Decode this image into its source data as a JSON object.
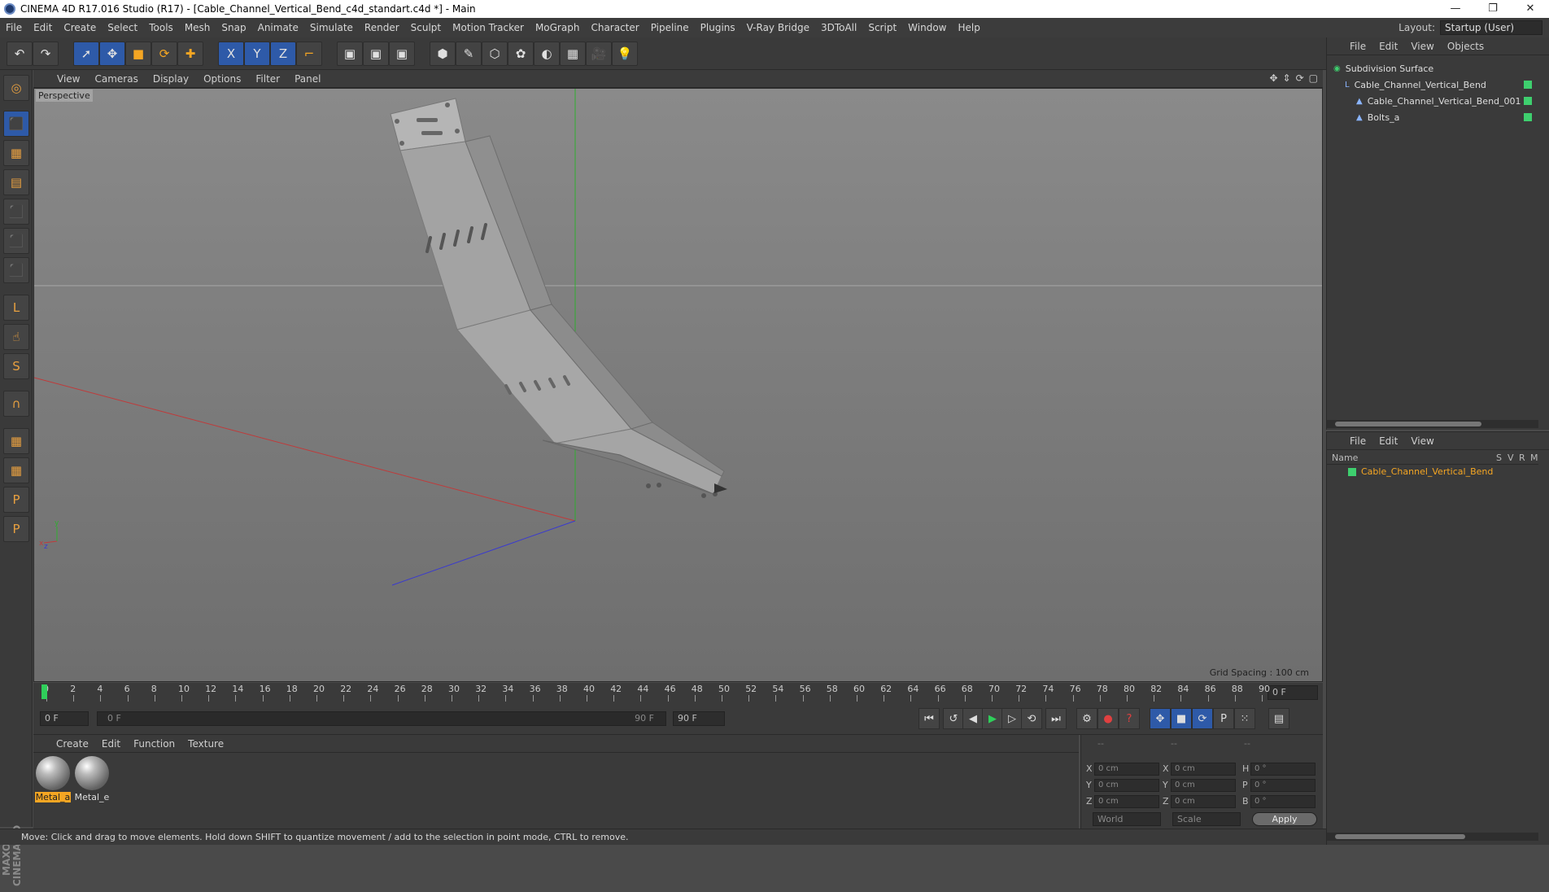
{
  "window": {
    "title": "CINEMA 4D R17.016 Studio (R17) - [Cable_Channel_Vertical_Bend_c4d_standart.c4d *] - Main",
    "minimize_icon": "minimize-icon",
    "restore_icon": "restore-icon",
    "close_icon": "close-icon"
  },
  "menu": {
    "items": [
      "File",
      "Edit",
      "Create",
      "Select",
      "Tools",
      "Mesh",
      "Snap",
      "Animate",
      "Simulate",
      "Render",
      "Sculpt",
      "Motion Tracker",
      "MoGraph",
      "Character",
      "Pipeline",
      "Plugins",
      "V-Ray Bridge",
      "3DToAll",
      "Script",
      "Window",
      "Help"
    ],
    "layout_label": "Layout:",
    "layout_value": "Startup (User)"
  },
  "toolbar": {
    "icons": [
      "undo-icon",
      "redo-icon",
      "select-cursor-icon",
      "move-icon",
      "scale-icon",
      "rotate-icon",
      "move-plus-icon",
      "x-axis-icon",
      "y-axis-icon",
      "z-axis-icon",
      "coordinate-system-icon",
      "render-view-icon",
      "render-picture-viewer-icon",
      "render-settings-icon",
      "cube-primitive-icon",
      "pen-spline-icon",
      "nurbs-icon",
      "cloner-icon",
      "deformer-icon",
      "floor-grid-icon",
      "camera-icon",
      "light-icon"
    ],
    "glyphs": [
      "↶",
      "↷",
      "➚",
      "✥",
      "■",
      "⟳",
      "✚",
      "X",
      "Y",
      "Z",
      "⌐",
      "▣",
      "▣",
      "▣",
      "⬢",
      "✎",
      "⬡",
      "✿",
      "◐",
      "▦",
      "🎥",
      "💡"
    ]
  },
  "left_tools": {
    "icons": [
      "make-editable-icon",
      "model-mode-icon",
      "texture-mode-icon",
      "workplane-icon",
      "points-mode-icon",
      "edges-mode-icon",
      "polygons-mode-icon",
      "axis-mode-icon",
      "tweak-mode-icon",
      "solo-icon",
      "snap-magnet-icon",
      "grid-lock-icon",
      "grid-snap-icon",
      "python-icon",
      "python-alt-icon"
    ],
    "glyphs": [
      "◎",
      "⬛",
      "▦",
      "▤",
      "⬛",
      "⬛",
      "⬛",
      "L",
      "☝",
      "S",
      "∩",
      "▦",
      "▦",
      "P",
      "P"
    ]
  },
  "maxon_logo": {
    "line1": "MAXON",
    "line2": "CINEMA 4D"
  },
  "viewport": {
    "menu": [
      "View",
      "Cameras",
      "Display",
      "Options",
      "Filter",
      "Panel"
    ],
    "camera_label": "Perspective",
    "grid_spacing": "Grid Spacing : 100 cm",
    "axis_y": "y",
    "axis_x": "x",
    "axis_z": "z",
    "colors": {
      "x_axis": "#c03a3a",
      "y_axis": "#2fae2f",
      "z_axis": "#3a3acf",
      "horizon": "#a8a8a8"
    }
  },
  "timeline": {
    "ticks": [
      "0",
      "2",
      "4",
      "6",
      "8",
      "10",
      "12",
      "14",
      "16",
      "18",
      "20",
      "22",
      "24",
      "26",
      "28",
      "30",
      "32",
      "34",
      "36",
      "38",
      "40",
      "42",
      "44",
      "46",
      "48",
      "50",
      "52",
      "54",
      "56",
      "58",
      "60",
      "62",
      "64",
      "66",
      "68",
      "70",
      "72",
      "74",
      "76",
      "78",
      "80",
      "82",
      "84",
      "86",
      "88",
      "90"
    ],
    "current_frame": "0 F"
  },
  "transport": {
    "start_field": "0 F",
    "range_start": "0 F",
    "range_end": "90 F",
    "end_field": "90 F",
    "buttons": [
      "go-to-start-icon",
      "previous-key-icon",
      "play-backward-icon",
      "play-forward-icon",
      "next-frame-icon",
      "loop-icon",
      "go-to-end-icon",
      "keyframe-record-icon",
      "autokey-icon",
      "key-help-icon",
      "move-key-icon",
      "scale-key-icon",
      "rotate-key-icon",
      "param-key-icon",
      "pla-key-icon",
      "timeline-icon"
    ],
    "glyphs": [
      "⏮",
      "↺",
      "◀",
      "▶",
      "▷",
      "⟲",
      "⏭",
      "⚙",
      "●",
      "?",
      "✥",
      "■",
      "⟳",
      "P",
      "⁙",
      "▤"
    ]
  },
  "materials": {
    "menu": [
      "Create",
      "Edit",
      "Function",
      "Texture"
    ],
    "items": [
      {
        "name": "Metal_a",
        "selected": true
      },
      {
        "name": "Metal_e",
        "selected": false
      }
    ]
  },
  "coordinates": {
    "header": [
      "--",
      "--",
      "--"
    ],
    "rows": [
      {
        "l1": "X",
        "v1": "0 cm",
        "l2": "X",
        "v2": "0 cm",
        "l3": "H",
        "v3": "0 °"
      },
      {
        "l1": "Y",
        "v1": "0 cm",
        "l2": "Y",
        "v2": "0 cm",
        "l3": "P",
        "v3": "0 °"
      },
      {
        "l1": "Z",
        "v1": "0 cm",
        "l2": "Z",
        "v2": "0 cm",
        "l3": "B",
        "v3": "0 °"
      }
    ],
    "world_select": "World",
    "scale_select": "Scale",
    "apply": "Apply"
  },
  "object_manager": {
    "menu": [
      "File",
      "Edit",
      "View",
      "Objects"
    ],
    "objects": [
      {
        "name": "Subdivision Surface",
        "icon": "subdivision-surface-icon",
        "indent": 0
      },
      {
        "name": "Cable_Channel_Vertical_Bend",
        "icon": "null-object-icon",
        "indent": 1
      },
      {
        "name": "Cable_Channel_Vertical_Bend_001",
        "icon": "polygon-object-icon",
        "indent": 2
      },
      {
        "name": "Bolts_a",
        "icon": "polygon-object-icon",
        "indent": 2
      }
    ]
  },
  "attribute_manager": {
    "menu": [
      "File",
      "Edit",
      "View"
    ],
    "columns": [
      "Name",
      "S",
      "V",
      "R",
      "M"
    ],
    "layer": "Cable_Channel_Vertical_Bend"
  },
  "status": {
    "text": "Move: Click and drag to move elements. Hold down SHIFT to quantize movement / add to the selection in point mode, CTRL to remove."
  }
}
